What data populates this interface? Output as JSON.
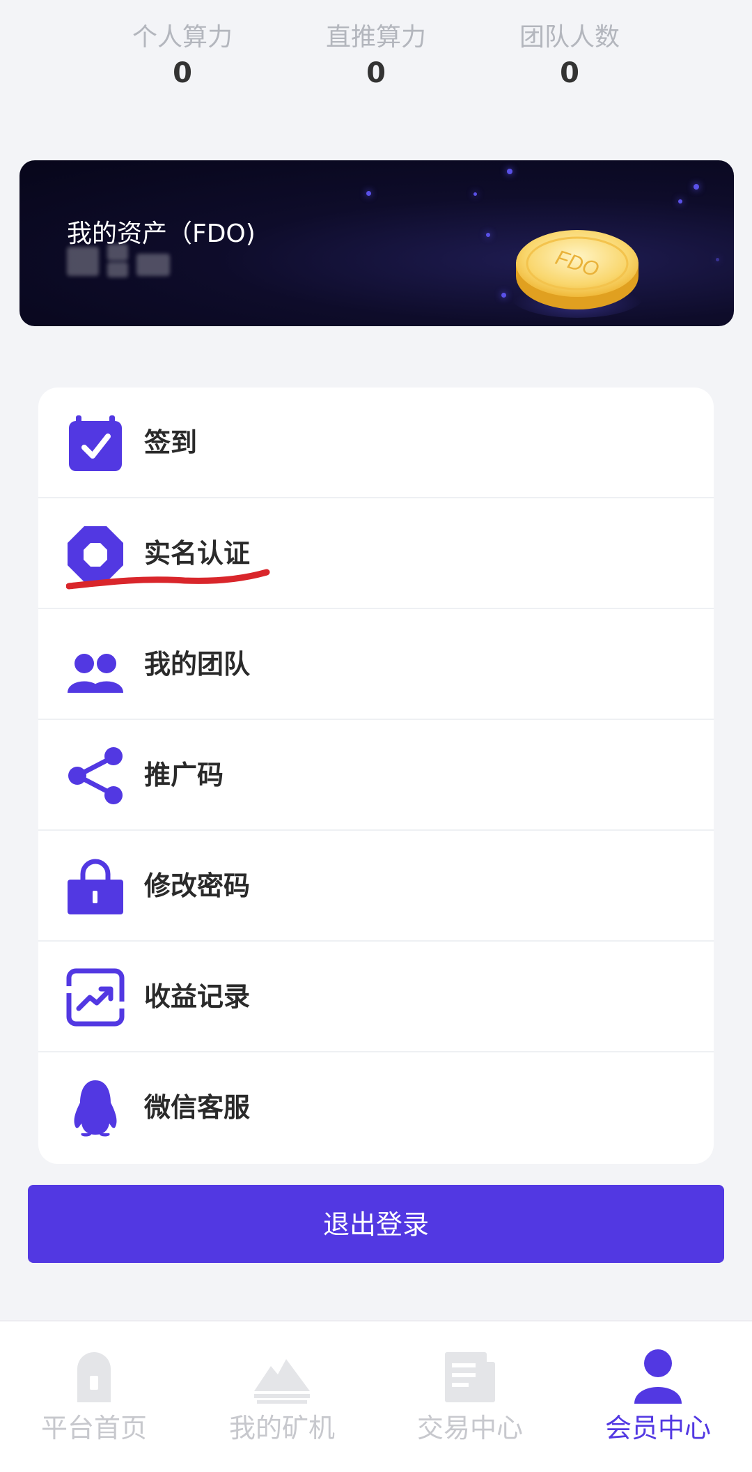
{
  "stats": [
    {
      "label": "个人算力",
      "value": "0"
    },
    {
      "label": "直推算力",
      "value": "0"
    },
    {
      "label": "团队人数",
      "value": "0"
    }
  ],
  "asset": {
    "title": "我的资产（FDO)",
    "coin_text": "FDO"
  },
  "menu": [
    {
      "label": "签到",
      "icon": "calendar-check-icon"
    },
    {
      "label": "实名认证",
      "icon": "octagon-icon"
    },
    {
      "label": "我的团队",
      "icon": "team-icon"
    },
    {
      "label": "推广码",
      "icon": "share-icon"
    },
    {
      "label": "修改密码",
      "icon": "lock-icon"
    },
    {
      "label": "收益记录",
      "icon": "trend-icon"
    },
    {
      "label": "微信客服",
      "icon": "penguin-icon"
    }
  ],
  "logout": {
    "label": "退出登录"
  },
  "nav": [
    {
      "label": "平台首页",
      "icon": "home-icon"
    },
    {
      "label": "我的矿机",
      "icon": "mountain-icon"
    },
    {
      "label": "交易中心",
      "icon": "document-icon"
    },
    {
      "label": "会员中心",
      "icon": "user-icon"
    }
  ],
  "colors": {
    "accent": "#5238e2",
    "background": "#f3f4f7",
    "inactive_nav": "#c7c8cd",
    "annotation": "#d9262b"
  }
}
